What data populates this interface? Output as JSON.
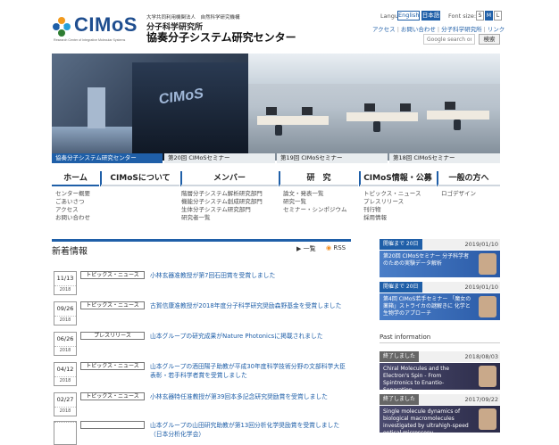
{
  "header": {
    "logo_text": "CIMoS",
    "logo_sub": "Research Center of Integrative Molecular Systems",
    "org_line1": "大学共同利用機関法人　自然科学研究機構",
    "org_line2": "分子科学研究所",
    "org_line3": "協奏分子システム研究センター",
    "language_label": "Language:",
    "lang_en": "English",
    "lang_ja": "日本語",
    "fontsize_label": "Font size:",
    "fs_s": "S",
    "fs_m": "M",
    "fs_l": "L",
    "links": [
      "アクセス",
      "お問い合わせ",
      "分子科学研究所",
      "リンク"
    ],
    "search_placeholder": "Google search on",
    "search_button": "検索"
  },
  "hero": {
    "wall_logo": "CIMoS",
    "captions": [
      "協奏分子システム研究センター",
      "第20回 CIMoSセミナー",
      "第19回 CIMoSセミナー",
      "第18回 CIMoSセミナー"
    ]
  },
  "nav": [
    {
      "label": "ホーム",
      "items": [
        "センター概要",
        "ごあいさつ",
        "アクセス",
        "お問い合わせ"
      ]
    },
    {
      "label": "CIMoSについて",
      "items": [
        "階層分子システム解析研究部門",
        "機能分子システム創成研究部門",
        "生体分子システム研究部門",
        "研究者一覧"
      ]
    },
    {
      "label": "メンバー",
      "items": []
    },
    {
      "label": "研　究",
      "items": [
        "論文・発表一覧",
        "研究一覧",
        "セミナー・シンポジウム"
      ]
    },
    {
      "label": "CIMoS情報・公募",
      "items": [
        "トピックス・ニュース",
        "プレスリリース",
        "刊行物",
        "採用情報"
      ]
    },
    {
      "label": "一般の方へ",
      "items": [
        "ロゴデザイン"
      ]
    }
  ],
  "news": {
    "title": "新着情報",
    "all_label": "一覧",
    "rss_label": "RSS",
    "items": [
      {
        "md": "11/13",
        "y": "2018",
        "category": "トピックス・ニュース",
        "text": "小林玄器准教授が第7回石田賞を受賞しました"
      },
      {
        "md": "09/26",
        "y": "2018",
        "category": "トピックス・ニュース",
        "text": "古賀信康准教授が2018年度分子科学研究奨励森野基金を受賞しました"
      },
      {
        "md": "06/26",
        "y": "2018",
        "category": "プレスリリース",
        "text": "山本グループの研究成果がNature Photonicsに掲載されました"
      },
      {
        "md": "04/12",
        "y": "2018",
        "category": "トピックス・ニュース",
        "text": "山本グループの酒田陽子助教が平成30年度科学技術分野の文部科学大臣表彰・若手科学者賞を受賞しました"
      },
      {
        "md": "02/27",
        "y": "2018",
        "category": "トピックス・ニュース",
        "text": "小林玄器特任准教授が第39回本多記念研究奨励賞を受賞しました"
      },
      {
        "md": "",
        "y": "",
        "category": "",
        "text": "山本グループの山田研究助教が第13回分析化学奨励賞を受賞しました（日本分析化学会）"
      }
    ]
  },
  "events": [
    {
      "tag": "開催まで 20日",
      "date": "2019/01/10",
      "banner": "第20回 CIMoSセミナー 分子科学者のための実験データ解析"
    },
    {
      "tag": "開催まで 20日",
      "date": "2019/01/10",
      "banner": "第4回 CIMoS若手セミナー 「魔女の薬箱」ストライカの謎解きに 化学と生物学のアプローチ"
    }
  ],
  "past_title": "Past information",
  "past": [
    {
      "tag": "終了しました",
      "date": "2018/08/03",
      "banner": "Chiral Molecules and the Electron's Spin - From Spintronics to Enantio-Separation"
    },
    {
      "tag": "終了しました",
      "date": "2017/09/22",
      "banner": "Single molecule dynamics of biological macromolecules investigated by ultrahigh-speed optical microscopy"
    }
  ]
}
